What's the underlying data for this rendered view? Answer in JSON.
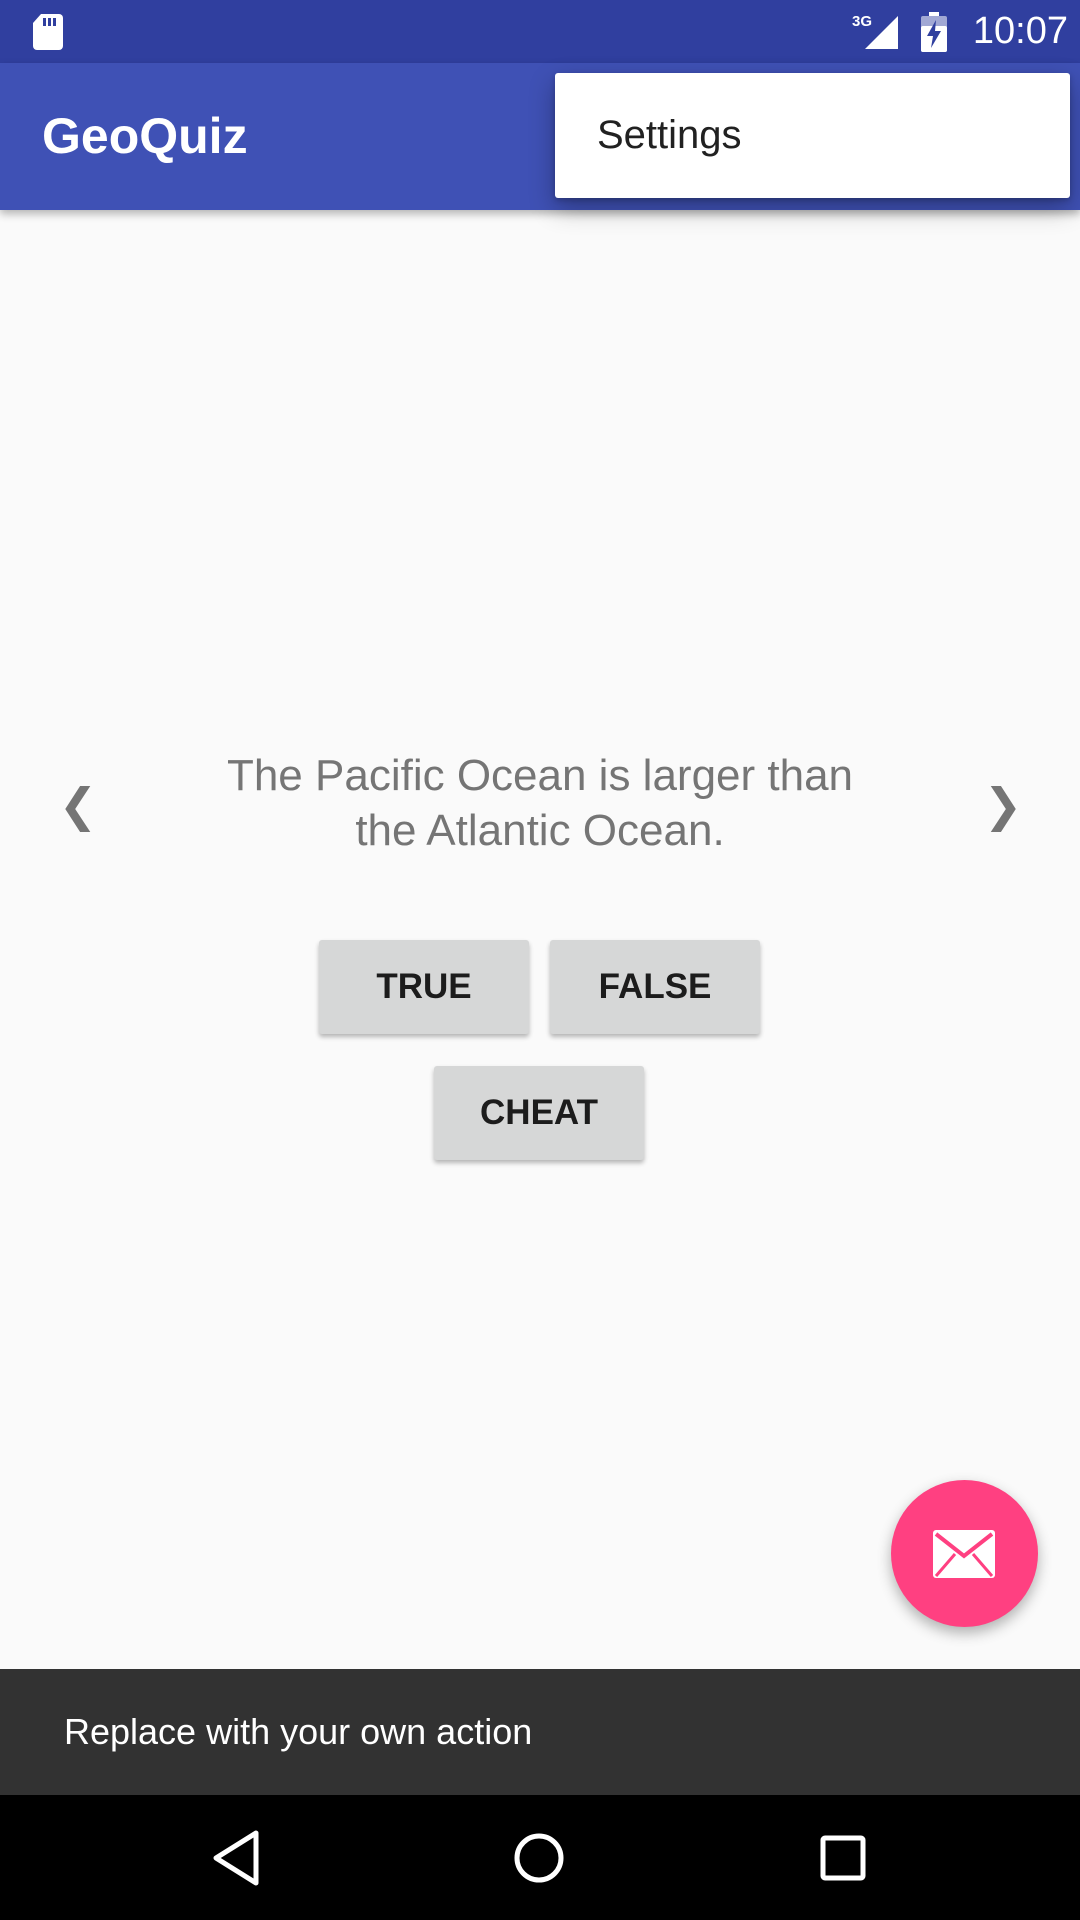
{
  "status_bar": {
    "time": "10:07",
    "network_type": "3G",
    "icons": [
      "sd-card-icon",
      "cell-signal-icon",
      "battery-charging-icon"
    ]
  },
  "app_bar": {
    "title": "GeoQuiz"
  },
  "overflow_menu": {
    "items": [
      {
        "label": "Settings"
      }
    ]
  },
  "quiz": {
    "prev_glyph": "❮",
    "question": "The Pacific Ocean is larger than the Atlantic Ocean.",
    "next_glyph": "❯",
    "true_label": "TRUE",
    "false_label": "FALSE",
    "cheat_label": "CHEAT"
  },
  "fab": {
    "icon": "email-icon"
  },
  "snackbar": {
    "text": "Replace with your own action"
  },
  "navigation_bar": {
    "icons": [
      "back-icon",
      "home-icon",
      "recents-icon"
    ]
  },
  "colors": {
    "status_bar": "#303f9f",
    "app_bar": "#3f51b5",
    "background": "#fafafa",
    "fab": "#ff4081",
    "snackbar": "#323232",
    "button": "#d6d7d7",
    "question_text": "#757575"
  }
}
